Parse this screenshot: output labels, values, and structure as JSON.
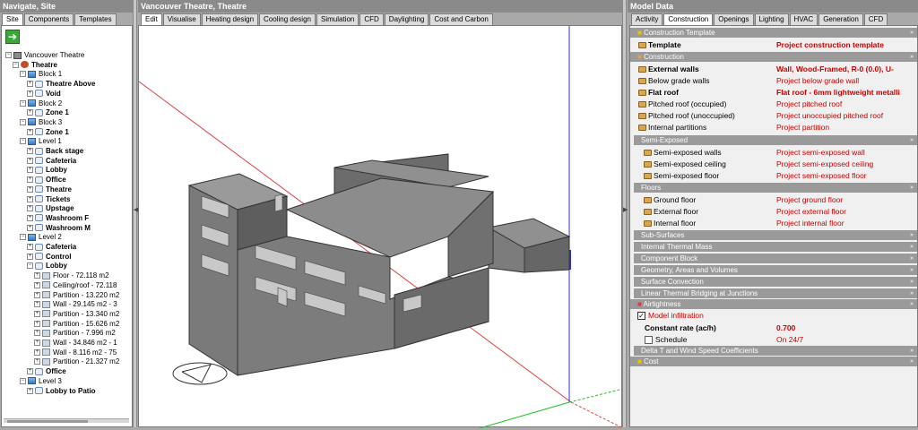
{
  "left": {
    "title": "Navigate, Site",
    "tabs": [
      "Site",
      "Components",
      "Templates"
    ],
    "tree": [
      {
        "label": "Vancouver Theatre",
        "icon": "site-icon",
        "bold": false
      },
      {
        "label": "Theatre",
        "icon": "building-icon",
        "bold": true
      },
      {
        "label": "Block 1",
        "icon": "block-icon",
        "bold": false
      },
      {
        "label": "Theatre Above",
        "icon": "zone-icon",
        "bold": true
      },
      {
        "label": "Void",
        "icon": "zone-icon",
        "bold": true
      },
      {
        "label": "Block 2",
        "icon": "block-icon",
        "bold": false
      },
      {
        "label": "Zone 1",
        "icon": "zone-icon",
        "bold": true
      },
      {
        "label": "Block 3",
        "icon": "block-icon",
        "bold": false
      },
      {
        "label": "Zone 1",
        "icon": "zone-icon",
        "bold": true
      },
      {
        "label": "Level 1",
        "icon": "block-icon",
        "bold": false
      },
      {
        "label": "Back stage",
        "icon": "zone-icon",
        "bold": true
      },
      {
        "label": "Cafeteria",
        "icon": "zone-icon",
        "bold": true
      },
      {
        "label": "Lobby",
        "icon": "zone-icon",
        "bold": true
      },
      {
        "label": "Office",
        "icon": "zone-icon",
        "bold": true
      },
      {
        "label": "Theatre",
        "icon": "zone-icon",
        "bold": true
      },
      {
        "label": "Tickets",
        "icon": "zone-icon",
        "bold": true
      },
      {
        "label": "Upstage",
        "icon": "zone-icon",
        "bold": true
      },
      {
        "label": "Washroom F",
        "icon": "zone-icon",
        "bold": true
      },
      {
        "label": "Washroom M",
        "icon": "zone-icon",
        "bold": true
      },
      {
        "label": "Level 2",
        "icon": "block-icon",
        "bold": false
      },
      {
        "label": "Cafeteria",
        "icon": "zone-icon",
        "bold": true
      },
      {
        "label": "Control",
        "icon": "zone-icon",
        "bold": true
      },
      {
        "label": "Lobby",
        "icon": "zone-icon",
        "bold": true
      },
      {
        "label": "Floor - 72.118 m2",
        "icon": "surface-icon",
        "bold": false
      },
      {
        "label": "Ceiling/roof - 72.118",
        "icon": "surface-icon",
        "bold": false
      },
      {
        "label": "Partition - 13.220 m2",
        "icon": "surface-icon",
        "bold": false
      },
      {
        "label": "Wall - 29.145 m2 - 3",
        "icon": "surface-icon",
        "bold": false
      },
      {
        "label": "Partition - 13.340 m2",
        "icon": "surface-icon",
        "bold": false
      },
      {
        "label": "Partition - 15.626 m2",
        "icon": "surface-icon",
        "bold": false
      },
      {
        "label": "Partition - 7.996 m2",
        "icon": "surface-icon",
        "bold": false
      },
      {
        "label": "Wall - 34.846 m2 - 1",
        "icon": "surface-icon",
        "bold": false
      },
      {
        "label": "Wall - 8.116 m2 - 75",
        "icon": "surface-icon",
        "bold": false
      },
      {
        "label": "Partition - 21.327 m2",
        "icon": "surface-icon",
        "bold": false
      },
      {
        "label": "Office",
        "icon": "zone-icon",
        "bold": true
      },
      {
        "label": "Level 3",
        "icon": "block-icon",
        "bold": false
      },
      {
        "label": "Lobby to Patio",
        "icon": "zone-icon",
        "bold": true
      }
    ]
  },
  "center": {
    "title": "Vancouver Theatre, Theatre",
    "tabs": [
      "Edit",
      "Visualise",
      "Heating design",
      "Cooling design",
      "Simulation",
      "CFD",
      "Daylighting",
      "Cost and Carbon"
    ]
  },
  "right": {
    "title": "Model Data",
    "tabs": [
      "Activity",
      "Construction",
      "Openings",
      "Lighting",
      "HVAC",
      "Generation",
      "CFD"
    ],
    "template_section": "Construction Template",
    "template_label": "Template",
    "template_value": "Project construction template",
    "construction_section": "Construction",
    "rows": [
      {
        "label": "External walls",
        "value": "Wall, Wood-Framed, R-0 (0.0), U-",
        "bold": true
      },
      {
        "label": "Below grade walls",
        "value": "Project below grade wall",
        "bold": false
      },
      {
        "label": "Flat roof",
        "value": "Flat roof - 6mm lightweight metalli",
        "bold": true
      },
      {
        "label": "Pitched roof (occupied)",
        "value": "Project pitched roof",
        "bold": false
      },
      {
        "label": "Pitched roof (unoccupied)",
        "value": "Project unoccupied pitched roof",
        "bold": false
      },
      {
        "label": "Internal partitions",
        "value": "Project partition",
        "bold": false
      }
    ],
    "semi_exposed_section": "Semi-Exposed",
    "semi_rows": [
      {
        "label": "Semi-exposed walls",
        "value": "Project semi-exposed wall"
      },
      {
        "label": "Semi-exposed ceiling",
        "value": "Project semi-exposed ceiling"
      },
      {
        "label": "Semi-exposed floor",
        "value": "Project semi-exposed floor"
      }
    ],
    "floors_section": "Floors",
    "floor_rows": [
      {
        "label": "Ground floor",
        "value": "Project ground floor"
      },
      {
        "label": "External floor",
        "value": "Project external floor"
      },
      {
        "label": "Internal floor",
        "value": "Project internal floor"
      }
    ],
    "collapsed_sections": [
      "Sub-Surfaces",
      "Internal Thermal Mass",
      "Component Block",
      "Geometry, Areas and Volumes",
      "Surface Convection",
      "Linear Thermal Bridging at Junctions"
    ],
    "airtightness_section": "Airtightness",
    "model_infiltration_label": "Model infiltration",
    "constant_rate_label": "Constant rate (ac/h)",
    "constant_rate_value": "0.700",
    "schedule_label": "Schedule",
    "schedule_value": "On 24/7",
    "delta_t_section": "Delta T and Wind Speed Coefficients",
    "cost_section": "Cost"
  }
}
